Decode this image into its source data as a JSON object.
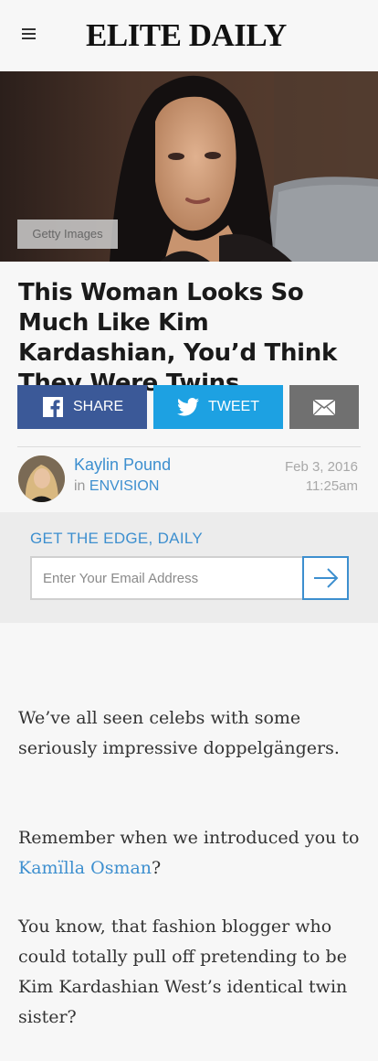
{
  "header": {
    "logo": "ELITE DAILY",
    "menu_icon": "hamburger-menu-icon"
  },
  "hero": {
    "credit": "Getty Images"
  },
  "article": {
    "headline": "This Woman Looks So Much Like Kim Kardashian, You’d Think They Were Twins"
  },
  "share": {
    "facebook_label": "SHARE",
    "twitter_label": "TWEET",
    "facebook_color": "#3b5998",
    "twitter_color": "#1da1e2",
    "email_color": "#707070",
    "icons": [
      "facebook-icon",
      "twitter-icon",
      "mail-icon"
    ]
  },
  "author": {
    "name": "Kaylin Pound",
    "in_prefix": "in",
    "category": "ENVISION",
    "date": "Feb 3, 2016",
    "time": "11:25am"
  },
  "newsletter": {
    "title": "GET THE EDGE, DAILY",
    "placeholder": "Enter Your Email Address",
    "submit_icon": "arrow-right-icon"
  },
  "body": {
    "p1": "We’ve all seen celebs with some seriously impressive doppelgängers.",
    "p2_before": "Remember when we introduced you to ",
    "p2_link": "Kamïlla Osman",
    "p2_after": "?",
    "p3": "You know, that fashion blogger who could totally pull off pretending to be Kim Kardashian West’s identical twin sister?"
  },
  "colors": {
    "accent": "#3d8fcf",
    "background": "#f7f7f7"
  }
}
